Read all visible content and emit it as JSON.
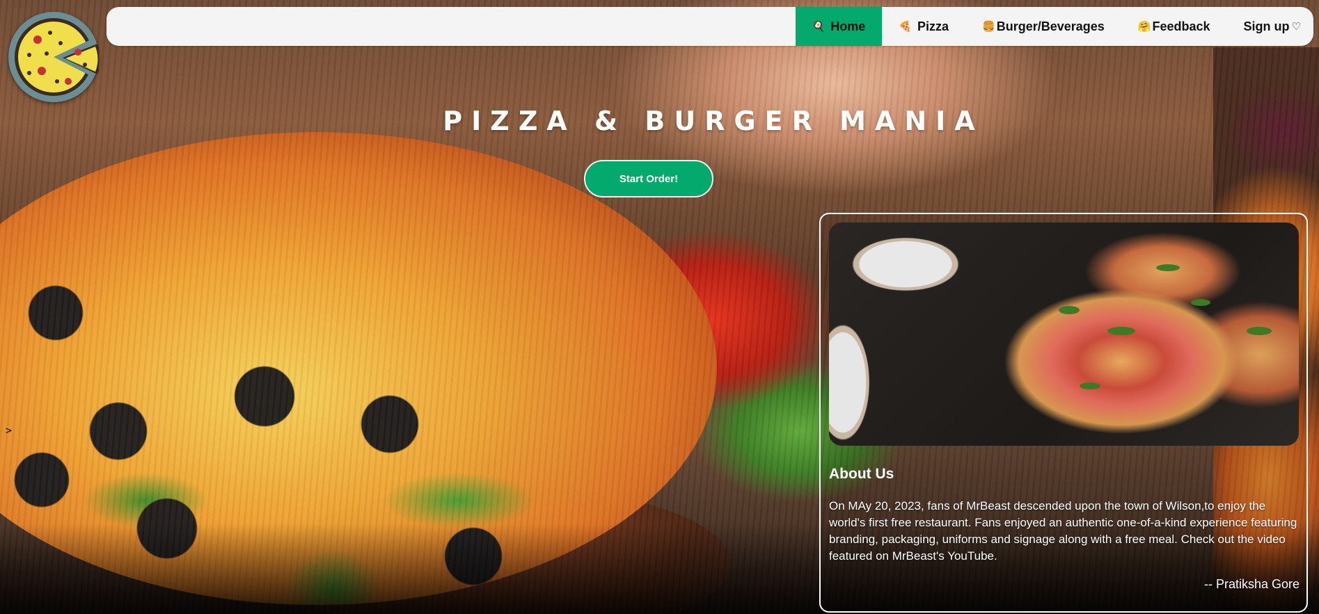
{
  "nav": {
    "items": [
      {
        "icon": "🍳",
        "label": "Home",
        "active": true
      },
      {
        "icon": "🍕",
        "label": "Pizza",
        "active": false
      },
      {
        "icon": "🍔",
        "label": "Burger/Beverages",
        "active": false
      },
      {
        "icon": "🤗",
        "label": "Feedback",
        "active": false
      },
      {
        "label": "Sign up",
        "icon_after": "♡",
        "active": false
      }
    ]
  },
  "hero": {
    "title": "PIZZA & BURGER MANIA",
    "cta_label": "Start Order!"
  },
  "side_arrow": ">",
  "about": {
    "heading": "About Us",
    "text": "On MAy 20, 2023, fans of MrBeast descended upon the town of Wilson,to enjoy the world's first free restaurant. Fans enjoyed an authentic one-of-a-kind experience featuring branding, packaging, uniforms and signage along with a free meal. Check out the video featured on MrBeast's YouTube.",
    "author": "-- Pratiksha Gore"
  },
  "colors": {
    "accent": "#04aa6d",
    "navbar_bg": "#f4f4f4",
    "text_light": "#ffffff"
  }
}
